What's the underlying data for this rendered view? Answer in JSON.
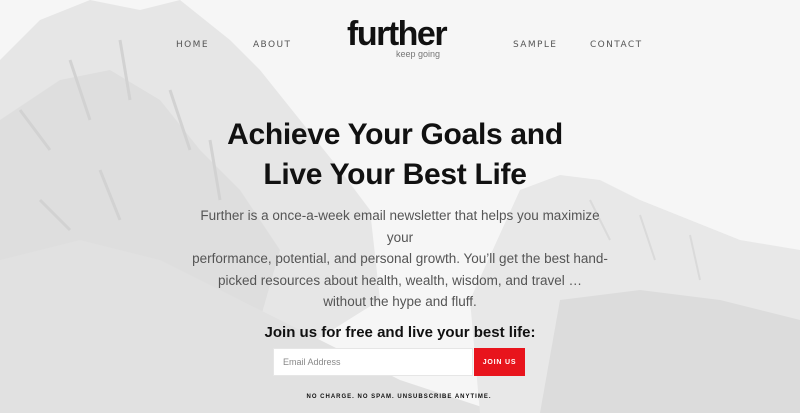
{
  "nav": {
    "home": "HOME",
    "about": "ABOUT",
    "sample": "SAMPLE",
    "contact": "CONTACT"
  },
  "logo": {
    "word": "further",
    "tagline": "keep going"
  },
  "hero": {
    "headline_line1": "Achieve Your Goals and",
    "headline_line2": "Live Your Best Life",
    "description_lines": [
      "Further is a once-a-week email newsletter that helps you maximize your",
      "performance, potential, and personal growth. You’ll get the best hand-",
      "picked resources about health, wealth, wisdom, and travel …",
      "without the hype and fluff."
    ]
  },
  "signup": {
    "cta": "Join us for free and live your best life:",
    "email_placeholder": "Email Address",
    "email_value": "",
    "button_label": "JOIN US",
    "fine_print": "NO CHARGE. NO SPAM. UNSUBSCRIBE ANYTIME."
  },
  "colors": {
    "accent": "#e8141c",
    "text": "#111111",
    "muted": "#555555"
  },
  "background": {
    "subject": "mountain-landscape"
  }
}
